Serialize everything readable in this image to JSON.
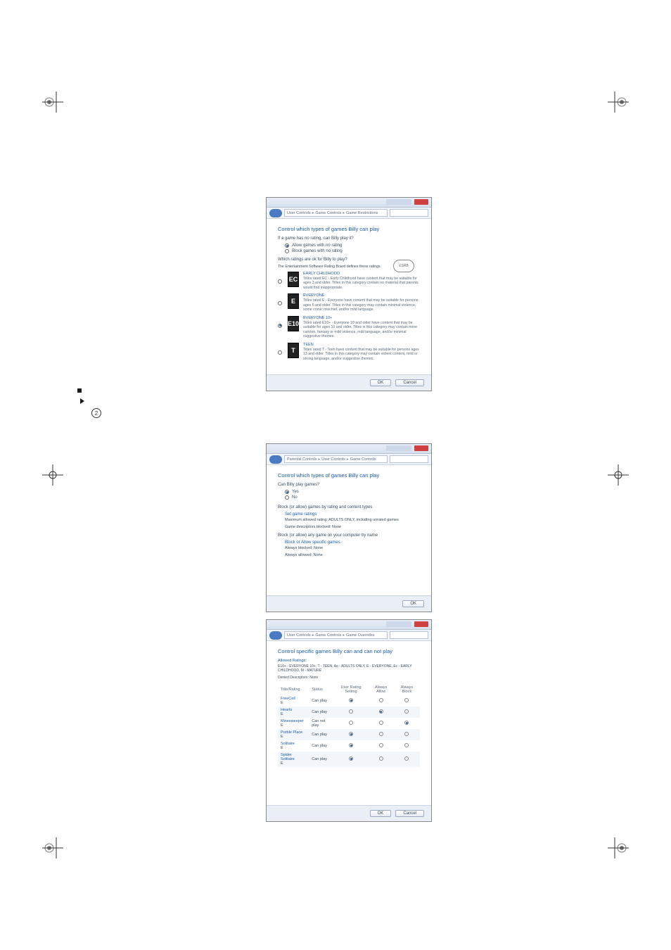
{
  "crop_marks": true,
  "windows": {
    "w1": {
      "breadcrumbs": [
        "User Controls",
        "Game Controls",
        "Game Restrictions"
      ],
      "heading": "Control which types of games Billy can play",
      "q1": "If a game has no rating, can Billy play it?",
      "opt_allow": "Allow games with no rating",
      "opt_block": "Block games with no rating",
      "q2": "Which ratings are ok for Billy to play?",
      "q2_sub": "The Entertainment Software Rating Board defines these ratings.",
      "esrb": "ESRB",
      "ratings": [
        {
          "code": "EC",
          "title": "EARLY CHILDHOOD",
          "desc": "Titles rated EC - Early Childhood have content that may be suitable for ages 3 and older. Titles in this category contain no material that parents would find inappropriate."
        },
        {
          "code": "E",
          "title": "EVERYONE",
          "desc": "Titles rated E - Everyone have content that may be suitable for persons ages 6 and older. Titles in this category may contain minimal violence, some comic mischief, and/or mild language."
        },
        {
          "code": "E10",
          "title": "EVERYONE 10+",
          "desc": "Titles rated E10+ - Everyone 10 and older have content that may be suitable for ages 10 and older. Titles in this category may contain more cartoon, fantasy or mild violence, mild language, and/or minimal suggestive themes."
        },
        {
          "code": "T",
          "title": "TEEN",
          "desc": "Titles rated T - Teen have content that may be suitable for persons ages 13 and older. Titles in this category may contain violent content, mild or strong language, and/or suggestive themes."
        }
      ],
      "ok": "OK",
      "cancel": "Cancel"
    },
    "w2": {
      "breadcrumbs": [
        "Parental Controls",
        "User Controls",
        "Game Controls"
      ],
      "heading": "Control which types of games Billy can play",
      "q1": "Can Billy play games?",
      "yes": "Yes",
      "no": "No",
      "q2": "Block (or allow) games by rating and content types",
      "set_ratings": "Set game ratings",
      "max_text": "Maximum allowed rating: ADULTS ONLY, including unrated games",
      "desc_text": "Game descriptors blocked: None",
      "q3": "Block (or allow) any game on your computer by name",
      "block_specific": "Block or Allow specific games",
      "always_blocked": "Always blocked: None",
      "always_allowed": "Always allowed: None",
      "ok": "OK"
    },
    "w3": {
      "breadcrumbs": [
        "User Controls",
        "Game Controls",
        "Game Overrides"
      ],
      "heading": "Control specific games Billy can and can not play",
      "allowed_label": "Allowed Ratings:",
      "allowed_line": "E10+ - EVERYONE 10+, T - TEEN, Ao - ADULTS ONLY, E - EVERYONE, Ec - EARLY CHILDHOOD, M - MATURE",
      "denied_label": "Denied Descriptors: None",
      "columns": [
        "Title/Rating",
        "Status",
        "User Rating Setting",
        "Always Allow",
        "Always Block"
      ],
      "rows": [
        {
          "name": "FreeCell",
          "rating": "E",
          "status": "Can play",
          "sel": 0
        },
        {
          "name": "Hearts",
          "rating": "E",
          "status": "Can play",
          "sel": 1
        },
        {
          "name": "Minesweeper",
          "rating": "E",
          "status": "Can not play",
          "sel": 2
        },
        {
          "name": "Purble Place",
          "rating": "E",
          "status": "Can play",
          "sel": 0
        },
        {
          "name": "Solitaire",
          "rating": "E",
          "status": "Can play",
          "sel": 0
        },
        {
          "name": "Spider Solitaire",
          "rating": "E",
          "status": "Can play",
          "sel": 0
        }
      ],
      "ok": "OK",
      "cancel": "Cancel"
    }
  },
  "bullets": {
    "step_icon": "2"
  }
}
